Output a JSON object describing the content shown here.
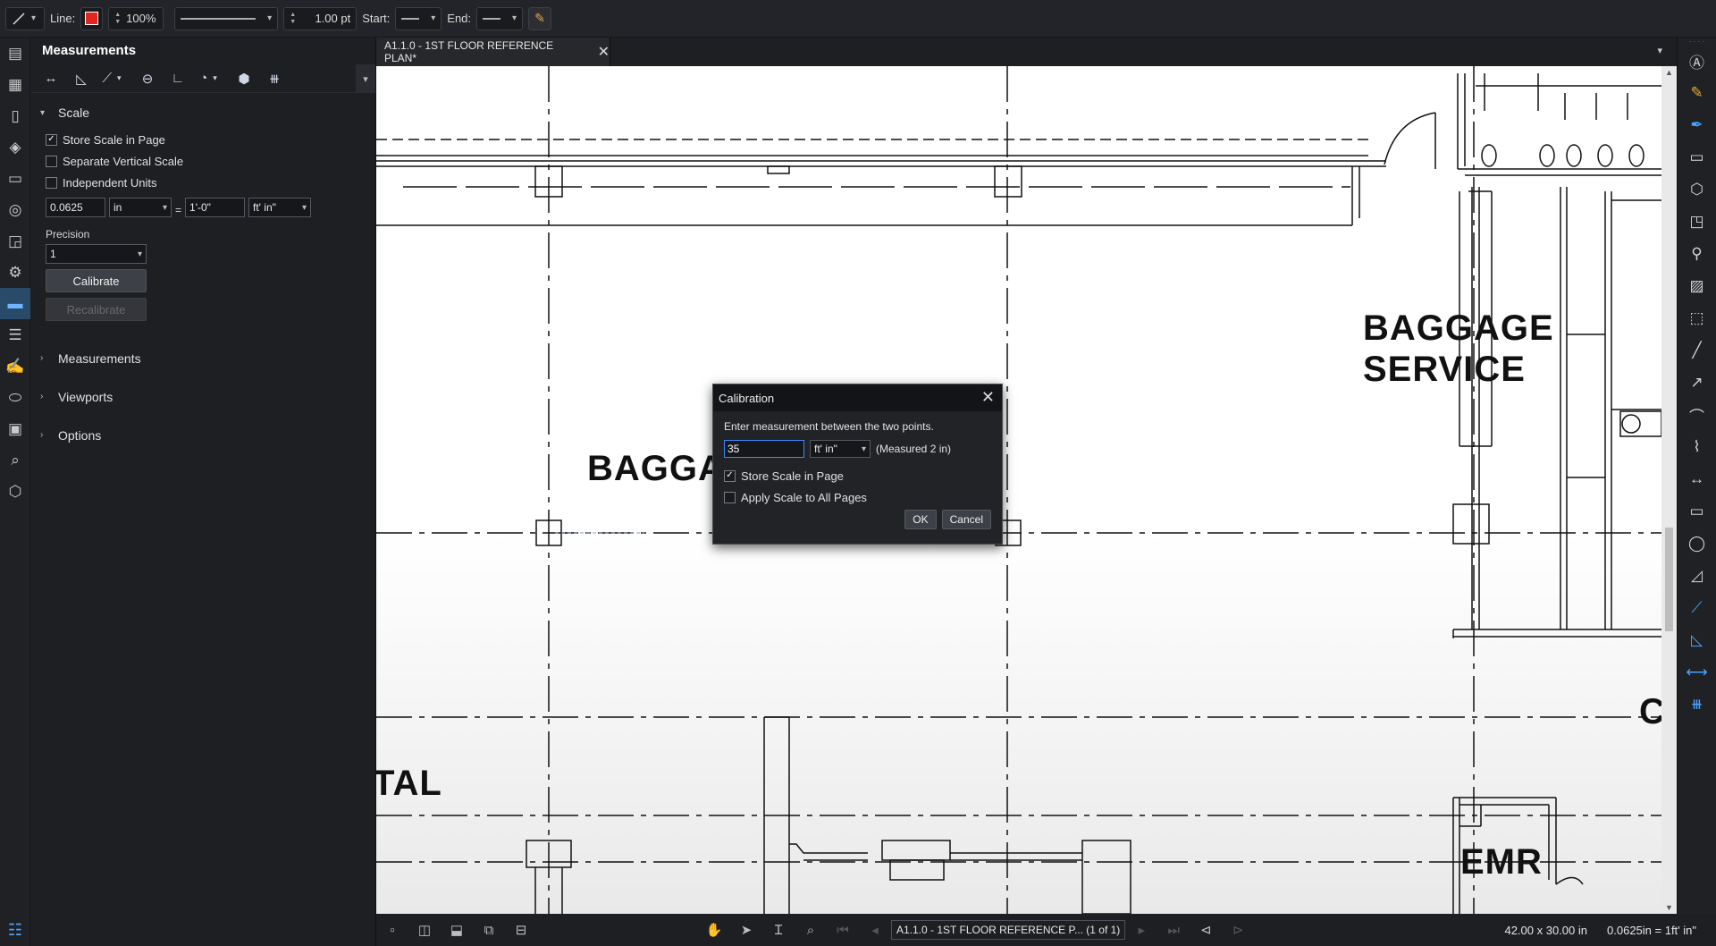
{
  "toolbar": {
    "line_label": "Line:",
    "opacity": "100%",
    "line_width": "1.00 pt",
    "start_label": "Start:",
    "end_label": "End:",
    "line_color": "#e0261f"
  },
  "panel": {
    "title": "Measurements",
    "scale_section": "Scale",
    "store_scale": "Store Scale in Page",
    "separate_vertical": "Separate Vertical Scale",
    "independent_units": "Independent Units",
    "scale_value": "0.0625",
    "scale_unit": "in",
    "scale_equals": "=",
    "scale_real": "1'-0\"",
    "scale_real_unit": "ft' in\"",
    "precision_label": "Precision",
    "precision_value": "1",
    "calibrate_label": "Calibrate",
    "disabled_button_label": "Recalibrate",
    "sections": [
      "Measurements",
      "Viewports",
      "Options"
    ]
  },
  "document": {
    "tab_title": "A1.1.0 - 1ST FLOOR REFERENCE PLAN*",
    "rooms": {
      "baggage_service_1": "BAGGAGE",
      "baggage_service_2": "SERVICE",
      "baggage_partial": "BAGGA",
      "tal_partial": "TAL",
      "emr": "EMR",
      "c_partial": "C"
    }
  },
  "dialog": {
    "title": "Calibration",
    "instruction": "Enter measurement between the two points.",
    "input_value": "35",
    "unit": "ft' in\"",
    "measured": "(Measured 2 in)",
    "store_scale": "Store Scale in Page",
    "apply_all": "Apply Scale to All Pages",
    "ok": "OK",
    "cancel": "Cancel"
  },
  "status": {
    "page_label": "A1.1.0 - 1ST FLOOR REFERENCE P... (1 of 1)",
    "page_size": "42.00 x 30.00 in",
    "scale": "0.0625in = 1ft' in\""
  }
}
